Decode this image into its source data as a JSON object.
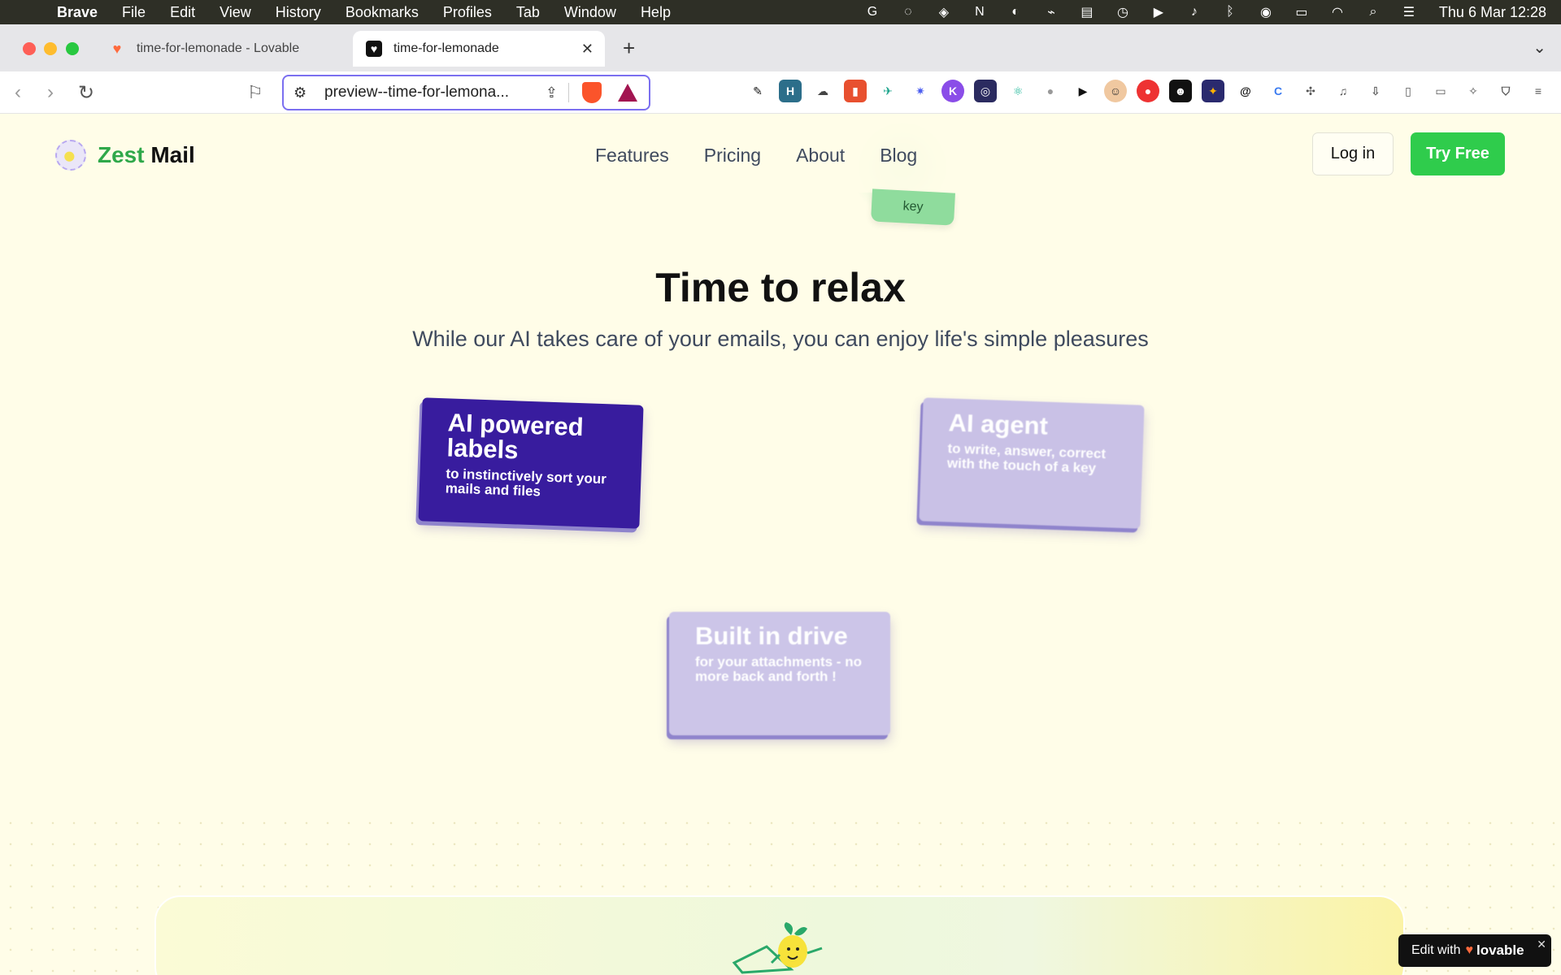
{
  "menubar": {
    "app": "Brave",
    "items": [
      "File",
      "Edit",
      "View",
      "History",
      "Bookmarks",
      "Profiles",
      "Tab",
      "Window",
      "Help"
    ],
    "clock": "Thu 6 Mar  12:28",
    "status_icons": [
      "grammarly-icon",
      "sync-icon",
      "shortcuts-icon",
      "notion-icon",
      "app-icon",
      "cast-icon",
      "keyboard-icon",
      "timer-icon",
      "play-icon",
      "volume-icon",
      "bluetooth-icon",
      "user-icon",
      "battery-icon",
      "wifi-icon",
      "search-icon",
      "control-center-icon"
    ]
  },
  "browser": {
    "tabs": [
      {
        "title": "time-for-lemonade - Lovable",
        "active": false
      },
      {
        "title": "time-for-lemonade",
        "active": true
      }
    ],
    "url": "preview--time-for-lemona..."
  },
  "site": {
    "logo": {
      "zest": "Zest",
      "mail": "Mail"
    },
    "nav": [
      "Features",
      "Pricing",
      "About",
      "Blog"
    ],
    "login": "Log in",
    "try_free": "Try Free",
    "keycap": "key"
  },
  "hero": {
    "title": "Time to relax",
    "subtitle": "While our AI takes care of your emails, you can enjoy life's simple pleasures"
  },
  "cards": [
    {
      "title": "AI powered labels",
      "subtitle": "to instinctively sort your mails and files"
    },
    {
      "title": "AI agent",
      "subtitle": "to write, answer, correct with the touch of a key"
    },
    {
      "title": "Built in drive",
      "subtitle": "for your attachments - no more back and forth !"
    }
  ],
  "badge": {
    "edit_with": "Edit with",
    "brand": "lovable"
  },
  "colors": {
    "brand_green": "#2fcc4c",
    "card_active": "#381c9e",
    "card_muted": "#c9c1e6",
    "page_bg": "#fffde8"
  }
}
